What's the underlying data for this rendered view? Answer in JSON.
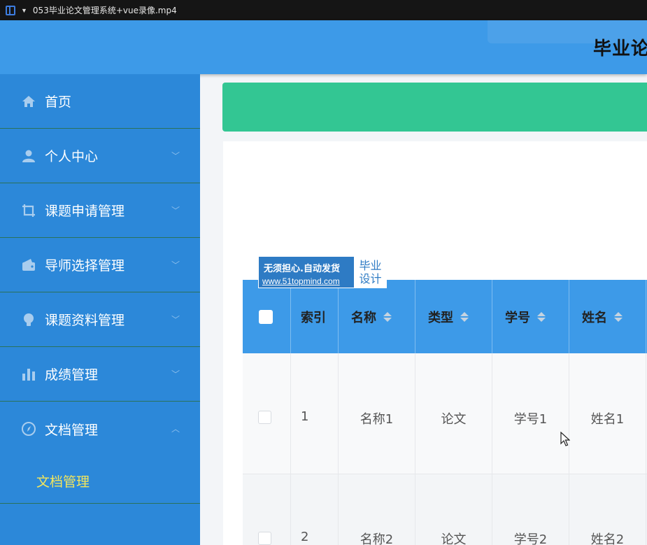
{
  "window": {
    "title": "053毕业论文管理系统+vue录像.mp4"
  },
  "header": {
    "brand": "毕业论"
  },
  "sidebar": {
    "items": [
      {
        "label": "首页",
        "icon": "home-icon",
        "expandable": false
      },
      {
        "label": "个人中心",
        "icon": "user-icon",
        "expandable": true,
        "expanded": false
      },
      {
        "label": "课题申请管理",
        "icon": "crop-icon",
        "expandable": true,
        "expanded": false
      },
      {
        "label": "导师选择管理",
        "icon": "wallet-icon",
        "expandable": true,
        "expanded": false
      },
      {
        "label": "课题资料管理",
        "icon": "bulb-icon",
        "expandable": true,
        "expanded": false
      },
      {
        "label": "成绩管理",
        "icon": "bar-chart-icon",
        "expandable": true,
        "expanded": false
      },
      {
        "label": "文档管理",
        "icon": "compass-icon",
        "expandable": true,
        "expanded": true
      }
    ],
    "submenu": {
      "label": "文档管理"
    }
  },
  "badge": {
    "line1": "无须担心.自动发货",
    "line2": "www.51topmind.com",
    "side_top": "毕业",
    "side_bottom": "设计"
  },
  "table": {
    "columns": [
      "索引",
      "名称",
      "类型",
      "学号",
      "姓名"
    ],
    "rows": [
      {
        "index": "1",
        "name": "名称1",
        "type": "论文",
        "student_id": "学号1",
        "student_name": "姓名1"
      },
      {
        "index": "2",
        "name": "名称2",
        "type": "论文",
        "student_id": "学号2",
        "student_name": "姓名2"
      }
    ]
  },
  "colors": {
    "header": "#3d9ae8",
    "sidebar": "#2c88d9",
    "accent_green": "#33c693",
    "submenu_active": "#f3e65c"
  }
}
